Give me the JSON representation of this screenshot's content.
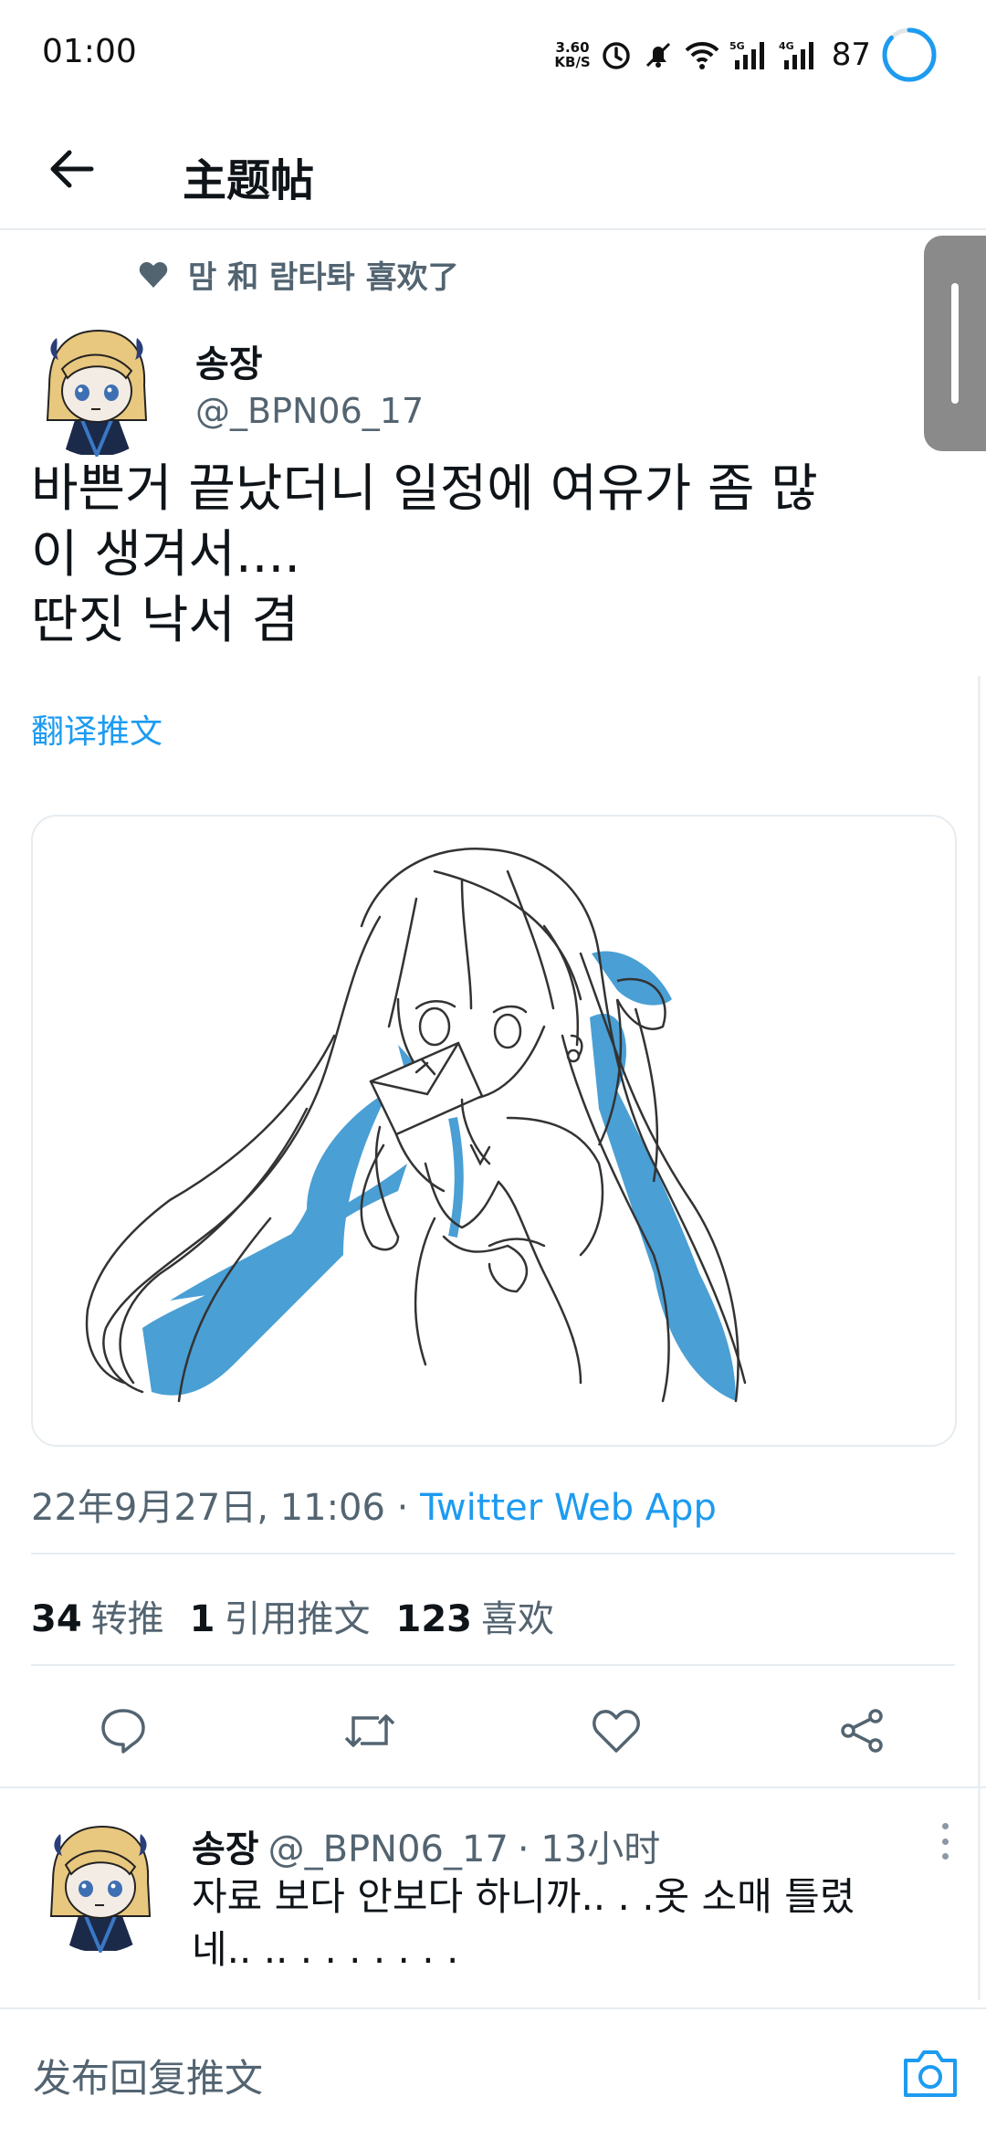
{
  "status_bar": {
    "time": "01:00",
    "net_speed_value": "3.60",
    "net_speed_unit": "KB/S",
    "signal1_label": "5G",
    "signal2_label": "4G",
    "battery_level": "87",
    "icons": [
      "alarm-icon",
      "mute-bell-icon",
      "wifi-icon",
      "signal-5g-icon",
      "signal-4g-icon",
      "battery-ring-icon"
    ]
  },
  "app_bar": {
    "title": "主题帖",
    "back_icon": "arrow-left-icon"
  },
  "social_context": {
    "text": "맘 和 람타톼 喜欢了",
    "icon": "heart-icon"
  },
  "tweet": {
    "author_name": "송장",
    "author_handle": "@_BPN06_17",
    "text": "바쁜거 끝났더니 일정에 여유가 좀 많\n이 생겨서....\n딴짓 낙서 겸",
    "translate_label": "翻译推文",
    "timestamp": "22年9月27日, 11:06 · ",
    "source_app": "Twitter Web App",
    "stats": {
      "retweets_count": "34",
      "retweets_label": "转推",
      "quotes_count": "1",
      "quotes_label": "引用推文",
      "likes_count": "123",
      "likes_label": "喜欢"
    }
  },
  "reply": {
    "author_name": "송장",
    "author_handle": "@_BPN06_17",
    "time": "· 13小时",
    "text": "자료 보다 안보다 하니까.. . .옷 소매 틀렸\n네.. .. . . . . . . ."
  },
  "compose": {
    "placeholder": "发布回复推文",
    "icon": "camera-icon"
  },
  "colors": {
    "accent": "#1d9bf0",
    "secondary_text": "#536471",
    "divider": "#e6ecf0",
    "sketch_blue": "#4a9fd4"
  }
}
